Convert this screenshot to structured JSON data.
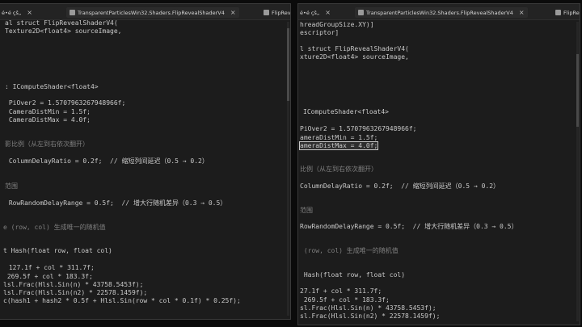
{
  "left_pane": {
    "tabs": [
      {
        "label": "é•é çš„ ",
        "close": "×"
      },
      {
        "label": "TransparentParticlesWin32.Shaders.FlipRevealShaderV4",
        "close": "×"
      },
      {
        "label": "FlipRev",
        "close": ""
      }
    ],
    "lines": [
      {
        "text": "al struct FlipRevealShaderV4(",
        "style": ""
      },
      {
        "text": "Texture2D<float4> sourceImage,",
        "style": ""
      },
      {
        "text": ": IComputeShader<float4>",
        "style": ""
      },
      {
        "text": " PiOver2 = 1.5707963267948966f;",
        "style": ""
      },
      {
        "text": " CameraDistMin = 1.5f;",
        "style": ""
      },
      {
        "text": " CameraDistMax = 4.0f;",
        "style": ""
      },
      {
        "text": "影比例（从左到右依次翻开）",
        "style": "comment"
      },
      {
        "text": " ColumnDelayRatio = 0.2f;  // 缩短列间延迟（0.5 → 0.2）",
        "style": ""
      },
      {
        "text": "范围",
        "style": "comment"
      },
      {
        "text": " RowRandomDelayRange = 0.5f;  // 增大行随机差异（0.3 → 0.5）",
        "style": ""
      },
      {
        "text": "e (row, col) 生成唯一的随机值",
        "style": "comment"
      },
      {
        "text": "t Hash(float row, float col)",
        "style": ""
      },
      {
        "text": " 127.1f + col * 311.7f;",
        "style": ""
      },
      {
        "text": " 269.5f + col * 183.3f;",
        "style": ""
      },
      {
        "text": "lsl.Frac(Hlsl.Sin(n) * 43758.5453f);",
        "style": ""
      },
      {
        "text": "lsl.Frac(Hlsl.Sin(n2) * 22578.1459f);",
        "style": ""
      },
      {
        "text": "c(hash1 + hash2 * 0.5f + Hlsl.Sin(row * col * 0.1f) * 0.25f);",
        "style": ""
      }
    ]
  },
  "right_pane": {
    "tabs": [
      {
        "label": "é•é çš„ ",
        "close": "×"
      },
      {
        "label": "TransparentParticlesWin32.Shaders.FlipRevealShaderV4",
        "close": "×"
      },
      {
        "label": "FlipRev",
        "close": ""
      }
    ],
    "lines": [
      {
        "text": "hreadGroupSize.XY)]",
        "style": ""
      },
      {
        "text": "escriptor]",
        "style": ""
      },
      {
        "text": "l struct FlipRevealShaderV4(",
        "style": ""
      },
      {
        "text": "xture2D<float4> sourceImage,",
        "style": ""
      },
      {
        "text": "IComputeShader<float4>",
        "style": ""
      },
      {
        "text": "PiOver2 = 1.5707963267948966f;",
        "style": ""
      },
      {
        "text": "ameraDistMin = 1.5f;",
        "style": ""
      },
      {
        "text": "ameraDistMax = 4.0f;",
        "style": "highlight"
      },
      {
        "text": "比例（从左到右依次翻开）",
        "style": "comment"
      },
      {
        "text": "ColumnDelayRatio = 0.2f;  // 缩短列间延迟（0.5 → 0.2）",
        "style": ""
      },
      {
        "text": "范围",
        "style": "comment"
      },
      {
        "text": "RowRandomDelayRange = 0.5f;  // 增大行随机差异（0.3 → 0.5）",
        "style": ""
      },
      {
        "text": " (row, col) 生成唯一的随机值",
        "style": "comment"
      },
      {
        "text": " Hash(float row, float col)",
        "style": ""
      },
      {
        "text": "27.1f + col * 311.7f;",
        "style": ""
      },
      {
        "text": " 269.5f + col * 183.3f;",
        "style": ""
      },
      {
        "text": "sl.Frac(Hlsl.Sin(n) * 43758.5453f);",
        "style": ""
      },
      {
        "text": "sl.Frac(Hlsl.Sin(n2) * 22578.1459f);",
        "style": ""
      }
    ]
  }
}
